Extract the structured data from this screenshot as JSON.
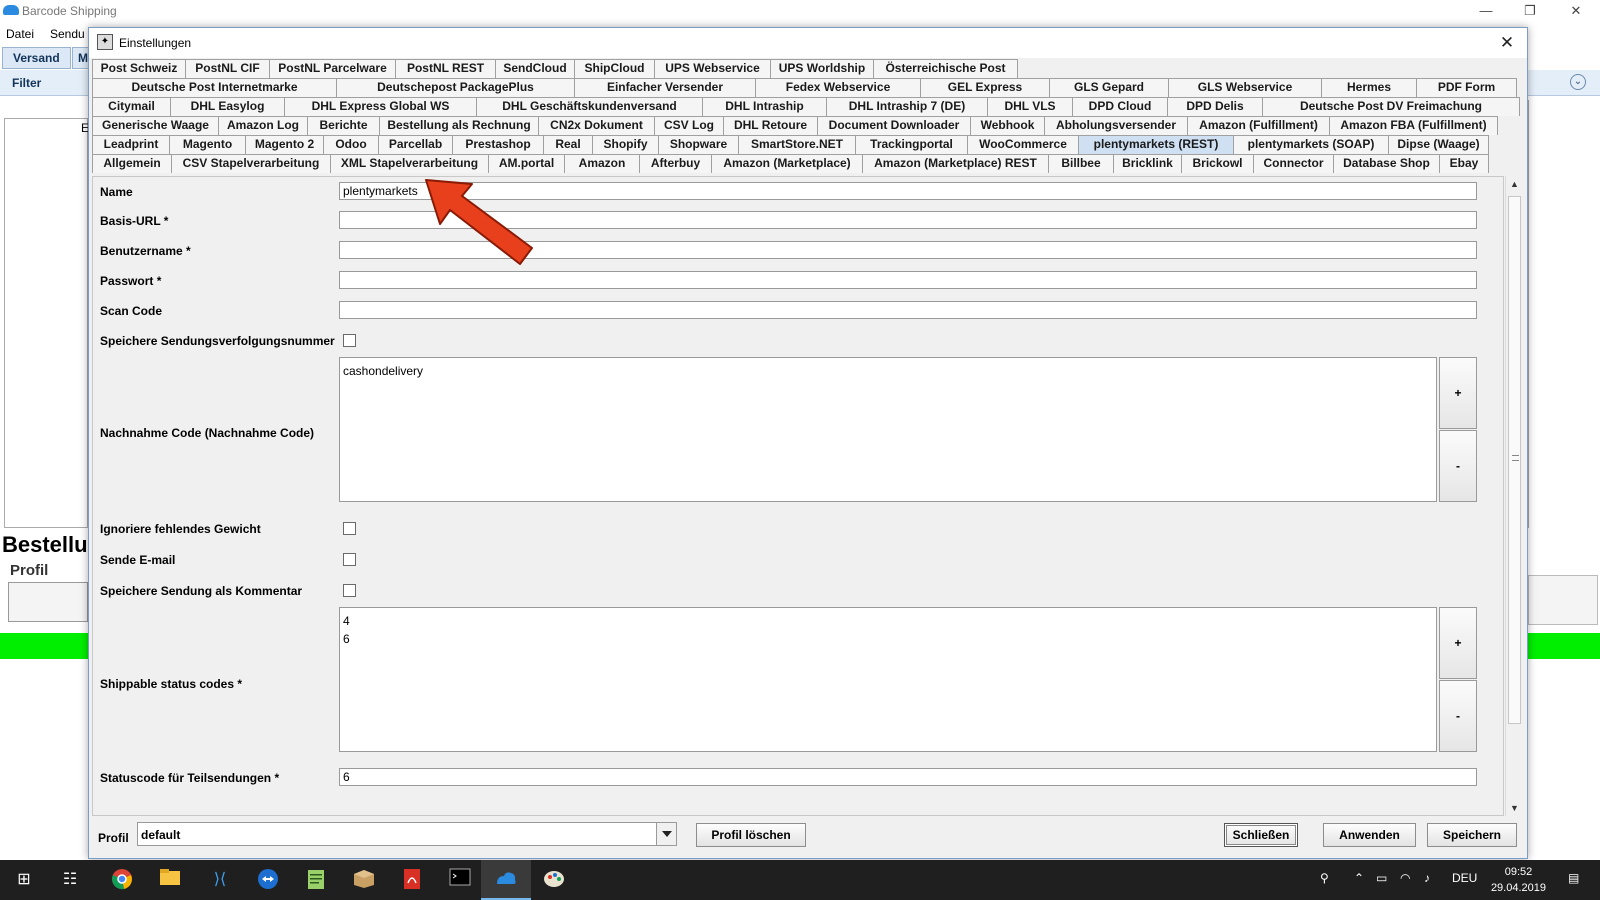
{
  "background_app": {
    "title": "Barcode Shipping",
    "menu": [
      "Datei",
      "Sendu"
    ],
    "tabs": [
      "Versand",
      "M"
    ],
    "filter_label": "Filter",
    "collapse_symbol": "⌄",
    "stray_letter": "E",
    "section_title": "Bestellu",
    "profile_label": "Profil"
  },
  "dialog": {
    "title": "Einstellungen",
    "tab_rows": [
      [
        "Post Schweiz",
        "PostNL CIF",
        "PostNL Parcelware",
        "PostNL REST",
        "SendCloud",
        "ShipCloud",
        "UPS Webservice",
        "UPS Worldship",
        "Österreichische Post"
      ],
      [
        "Deutsche Post Internetmarke",
        "Deutschepost PackagePlus",
        "Einfacher Versender",
        "Fedex Webservice",
        "GEL Express",
        "GLS Gepard",
        "GLS Webservice",
        "Hermes",
        "PDF Form"
      ],
      [
        "Citymail",
        "DHL Easylog",
        "DHL Express Global WS",
        "DHL Geschäftskundenversand",
        "DHL Intraship",
        "DHL Intraship 7 (DE)",
        "DHL VLS",
        "DPD Cloud",
        "DPD Delis",
        "Deutsche Post DV Freimachung"
      ],
      [
        "Generische Waage",
        "Amazon Log",
        "Berichte",
        "Bestellung als Rechnung",
        "CN2x Dokument",
        "CSV Log",
        "DHL Retoure",
        "Document Downloader",
        "Webhook",
        "Abholungsversender",
        "Amazon (Fulfillment)",
        "Amazon FBA (Fulfillment)"
      ],
      [
        "Leadprint",
        "Magento",
        "Magento 2",
        "Odoo",
        "Parcellab",
        "Prestashop",
        "Real",
        "Shopify",
        "Shopware",
        "SmartStore.NET",
        "Trackingportal",
        "WooCommerce",
        "plentymarkets (REST)",
        "plentymarkets (SOAP)",
        "Dipse (Waage)"
      ],
      [
        "Allgemein",
        "CSV Stapelverarbeitung",
        "XML Stapelverarbeitung",
        "AM.portal",
        "Amazon",
        "Afterbuy",
        "Amazon (Marketplace)",
        "Amazon (Marketplace) REST",
        "Billbee",
        "Bricklink",
        "Brickowl",
        "Connector",
        "Database Shop",
        "Ebay"
      ]
    ],
    "active_tab": "plentymarkets (REST)",
    "fields": {
      "name_label": "Name",
      "name_value": "plentymarkets",
      "base_url_label": "Basis-URL *",
      "base_url_value": "",
      "username_label": "Benutzername *",
      "username_value": "",
      "password_label": "Passwort *",
      "password_value": "",
      "scan_code_label": "Scan Code",
      "scan_code_value": "",
      "save_tracking_label": "Speichere Sendungsverfolgungsnummer",
      "cod_label": "Nachnahme Code (Nachnahme Code)",
      "cod_items": [
        "cashondelivery"
      ],
      "ignore_weight_label": "Ignoriere fehlendes Gewicht",
      "send_email_label": "Sende E-mail",
      "save_comment_label": "Speichere Sendung als Kommentar",
      "shippable_label": "Shippable status codes *",
      "shippable_items": [
        "4",
        "6"
      ],
      "partial_status_label": "Statuscode für Teilsendungen *",
      "partial_status_value": "6",
      "add_symbol": "+",
      "remove_symbol": "-"
    },
    "footer": {
      "profile_label": "Profil",
      "profile_value": "default",
      "delete_profile": "Profil löschen",
      "close": "Schließen",
      "apply": "Anwenden",
      "save": "Speichern"
    }
  },
  "taskbar": {
    "language": "DEU",
    "time": "09:52",
    "date": "29.04.2019"
  },
  "colors": {
    "accent_green": "#00ee00",
    "active_tab": "#cfe0f3",
    "arrow_red": "#e8401c"
  }
}
